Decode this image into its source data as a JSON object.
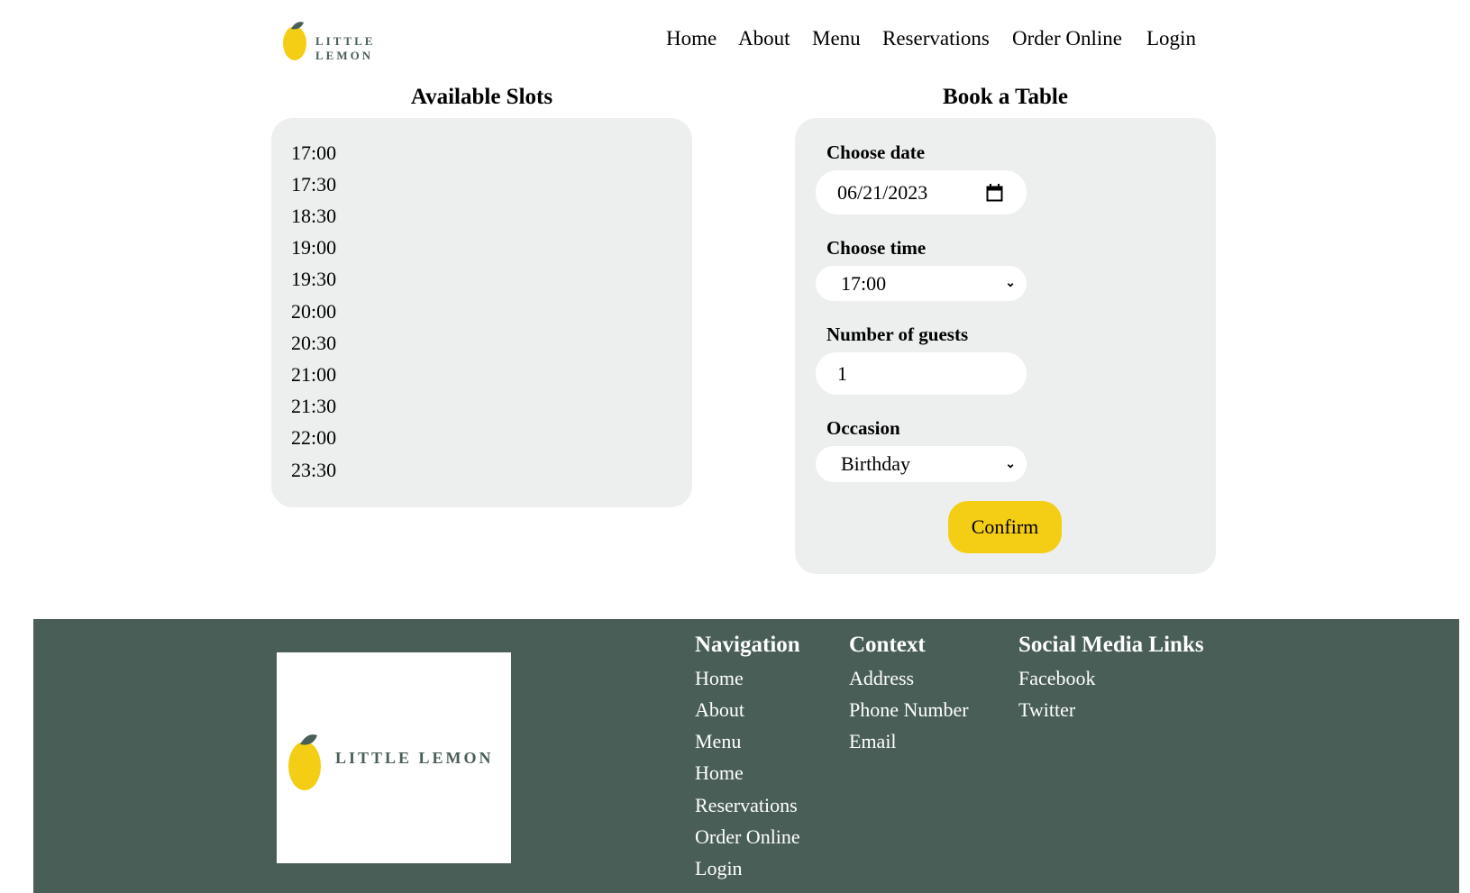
{
  "header": {
    "logo_text": "LITTLE LEMON",
    "nav": [
      "Home",
      "About",
      "Menu",
      "Reservations",
      "Order Online",
      "Login"
    ]
  },
  "slots": {
    "title": "Available Slots",
    "times": [
      "17:00",
      "17:30",
      "18:30",
      "19:00",
      "19:30",
      "20:00",
      "20:30",
      "21:00",
      "21:30",
      "22:00",
      "23:30"
    ]
  },
  "booking": {
    "title": "Book a Table",
    "date_label": "Choose date",
    "date_value": "06/21/2023",
    "time_label": "Choose time",
    "time_value": "17:00",
    "guests_label": "Number of guests",
    "guests_value": "1",
    "occasion_label": "Occasion",
    "occasion_value": "Birthday",
    "confirm_label": "Confirm"
  },
  "footer": {
    "logo_text": "LITTLE LEMON",
    "navigation": {
      "title": "Navigation",
      "items": [
        "Home",
        "About",
        "Menu",
        "Home",
        "Reservations",
        "Order Online",
        "Login"
      ]
    },
    "context": {
      "title": "Context",
      "items": [
        "Address",
        "Phone Number",
        "Email"
      ]
    },
    "social": {
      "title": "Social Media Links",
      "items": [
        "Facebook",
        "Twitter"
      ]
    }
  },
  "colors": {
    "primary": "#495e57",
    "accent": "#f4ce14",
    "panel": "#edefee"
  }
}
